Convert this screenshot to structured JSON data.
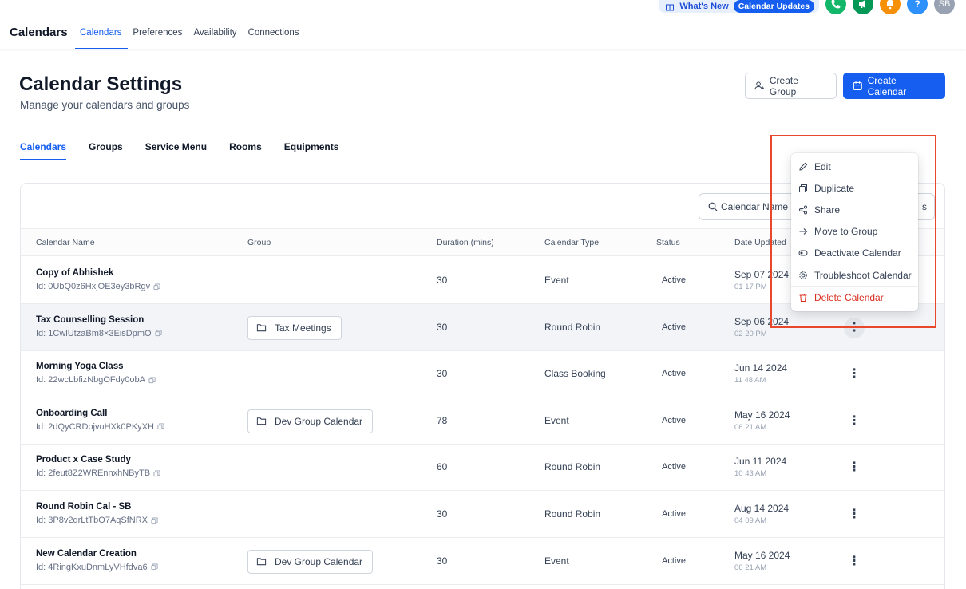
{
  "utility": {
    "whats_new": "What's New",
    "updates": "Calendar Updates",
    "avatar_initials": "SB",
    "help_glyph": "?",
    "colors": {
      "phone": "#12b76a",
      "megaphone": "#039855",
      "bell": "#f79009",
      "help": "#2e90fa",
      "avatar": "#98a2b3"
    }
  },
  "nav": {
    "brand": "Calendars",
    "tabs": [
      {
        "label": "Calendars",
        "active": true
      },
      {
        "label": "Preferences"
      },
      {
        "label": "Availability"
      },
      {
        "label": "Connections"
      }
    ]
  },
  "header": {
    "title": "Calendar Settings",
    "subtitle": "Manage your calendars and groups",
    "create_group": "Create Group",
    "create_calendar": "Create Calendar"
  },
  "subtabs": [
    "Calendars",
    "Groups",
    "Service Menu",
    "Rooms",
    "Equipments"
  ],
  "search": {
    "placeholder": "Calendar Name",
    "suffix": "s"
  },
  "table": {
    "columns": [
      "Calendar Name",
      "Group",
      "Duration (mins)",
      "Calendar Type",
      "Status",
      "Date Updated"
    ],
    "rows": [
      {
        "name": "Copy of Abhishek",
        "id": "Id: 0UbQ0z6HxjOE3ey3bRgv",
        "group": "",
        "duration": "30",
        "type": "Event",
        "status": "Active",
        "date": "Sep 07 2024",
        "time": "01 17 PM"
      },
      {
        "name": "Tax Counselling Session",
        "id": "Id: 1CwlUtzaBm8×3EisDpmO",
        "group": "Tax Meetings",
        "duration": "30",
        "type": "Round Robin",
        "status": "Active",
        "date": "Sep 06 2024",
        "time": "02 20 PM"
      },
      {
        "name": "Morning Yoga Class",
        "id": "Id: 22wcLbfizNbgOFdy0obA",
        "group": "",
        "duration": "30",
        "type": "Class Booking",
        "status": "Active",
        "date": "Jun 14 2024",
        "time": "11 48 AM"
      },
      {
        "name": "Onboarding Call",
        "id": "Id: 2dQyCRDpjvuHXk0PKyXH",
        "group": "Dev Group Calendar",
        "duration": "78",
        "type": "Event",
        "status": "Active",
        "date": "May 16 2024",
        "time": "06 21 AM"
      },
      {
        "name": "Product x Case Study",
        "id": "Id: 2feut8Z2WREnnxhNByTB",
        "group": "",
        "duration": "60",
        "type": "Round Robin",
        "status": "Active",
        "date": "Jun 11 2024",
        "time": "10 43 AM"
      },
      {
        "name": "Round Robin Cal - SB",
        "id": "Id: 3P8v2qrLtTbO7AqSfNRX",
        "group": "",
        "duration": "30",
        "type": "Round Robin",
        "status": "Active",
        "date": "Aug 14 2024",
        "time": "04 09 AM"
      },
      {
        "name": "New Calendar Creation",
        "id": "Id: 4RingKxuDnmLyVHfdva6",
        "group": "Dev Group Calendar",
        "duration": "30",
        "type": "Event",
        "status": "Active",
        "date": "May 16 2024",
        "time": "06 21 AM"
      }
    ]
  },
  "menu": {
    "items": [
      {
        "label": "Edit",
        "icon": "pencil-icon"
      },
      {
        "label": "Duplicate",
        "icon": "duplicate-icon"
      },
      {
        "label": "Share",
        "icon": "share-icon"
      },
      {
        "label": "Move to Group",
        "icon": "arrow-right-icon"
      },
      {
        "label": "Deactivate Calendar",
        "icon": "toggle-icon"
      },
      {
        "label": "Troubleshoot Calendar",
        "icon": "gear-icon"
      },
      {
        "label": "Delete Calendar",
        "icon": "trash-icon",
        "danger": true
      }
    ]
  },
  "accent": "#155eef",
  "danger": "#d92d20",
  "highlight_color": "#e8472b"
}
